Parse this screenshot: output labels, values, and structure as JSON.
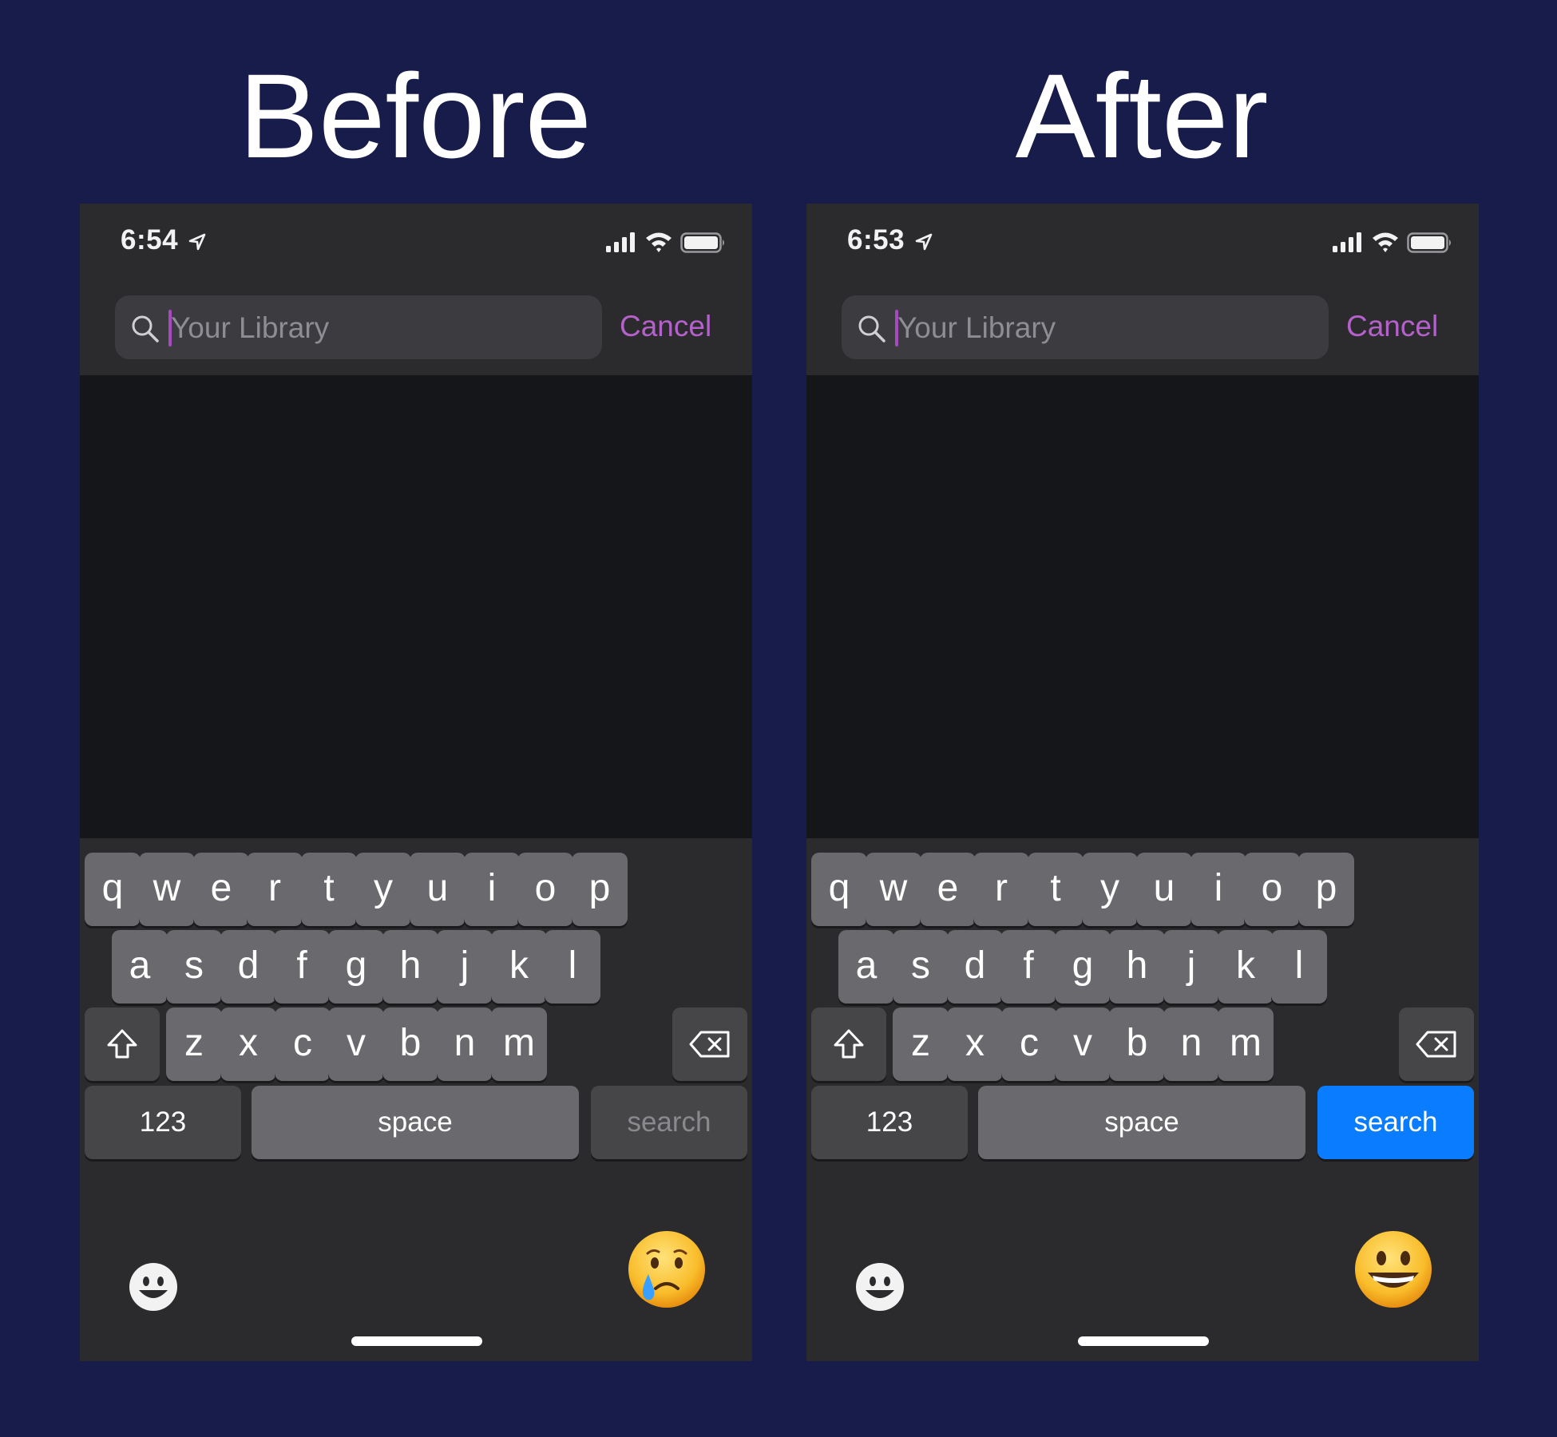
{
  "panels": [
    {
      "title": "Before",
      "status": {
        "time": "6:54"
      },
      "search": {
        "placeholder": "Your Library",
        "cancel_label": "Cancel"
      },
      "keyboard": {
        "row1": [
          "q",
          "w",
          "e",
          "r",
          "t",
          "y",
          "u",
          "i",
          "o",
          "p"
        ],
        "row2": [
          "a",
          "s",
          "d",
          "f",
          "g",
          "h",
          "j",
          "k",
          "l"
        ],
        "row3": [
          "z",
          "x",
          "c",
          "v",
          "b",
          "n",
          "m"
        ],
        "numbers_label": "123",
        "space_label": "space",
        "search_label": "search",
        "search_key_state": "disabled"
      },
      "reaction_emoji": "crying-face-icon"
    },
    {
      "title": "After",
      "status": {
        "time": "6:53"
      },
      "search": {
        "placeholder": "Your Library",
        "cancel_label": "Cancel"
      },
      "keyboard": {
        "row1": [
          "q",
          "w",
          "e",
          "r",
          "t",
          "y",
          "u",
          "i",
          "o",
          "p"
        ],
        "row2": [
          "a",
          "s",
          "d",
          "f",
          "g",
          "h",
          "j",
          "k",
          "l"
        ],
        "row3": [
          "z",
          "x",
          "c",
          "v",
          "b",
          "n",
          "m"
        ],
        "numbers_label": "123",
        "space_label": "space",
        "search_label": "search",
        "search_key_state": "active"
      },
      "reaction_emoji": "grinning-face-icon"
    }
  ],
  "colors": {
    "background": "#171c4b",
    "accent_purple": "#b561cc",
    "search_key_active": "#0a7cff",
    "key_gray": "#6a6a6e",
    "function_key_gray": "#464649"
  }
}
